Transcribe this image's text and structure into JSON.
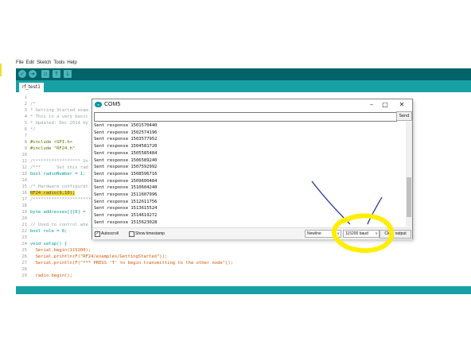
{
  "menu": [
    "File",
    "Edit",
    "Sketch",
    "Tools",
    "Help"
  ],
  "toolbar": {
    "icons": [
      "verify-icon",
      "upload-icon",
      "new-icon",
      "open-icon",
      "save-icon"
    ],
    "accent": "#006468"
  },
  "tab": {
    "label": "rf_test1"
  },
  "code": [
    {
      "n": "1",
      "t": ""
    },
    {
      "n": "2",
      "t": "/*"
    },
    {
      "n": "3",
      "t": "* Getting Started exam"
    },
    {
      "n": "4",
      "t": "* This is a very basic"
    },
    {
      "n": "5",
      "t": "* Updated: Dec 2014 by"
    },
    {
      "n": "6",
      "t": "*/"
    },
    {
      "n": "7",
      "t": ""
    },
    {
      "n": "8",
      "t": "#include <SPI.h>"
    },
    {
      "n": "9",
      "t": "#include \"RF24.h\""
    },
    {
      "n": "10",
      "t": ""
    },
    {
      "n": "11",
      "t": "/****************** Us"
    },
    {
      "n": "12",
      "t": "/***      Set this rad"
    },
    {
      "n": "13",
      "t": "bool radioNumber = 1;"
    },
    {
      "n": "14",
      "t": ""
    },
    {
      "n": "15",
      "t": "/* Hardware configurat"
    },
    {
      "n": "16",
      "t": "RF24 radio(9,10);"
    },
    {
      "n": "17",
      "t": "/**********************"
    },
    {
      "n": "18",
      "t": ""
    },
    {
      "n": "19",
      "t": "byte addresses[][6] ="
    },
    {
      "n": "20",
      "t": ""
    },
    {
      "n": "21",
      "t": "// Used to control whe"
    },
    {
      "n": "22",
      "t": "bool role = 0;"
    },
    {
      "n": "23",
      "t": ""
    },
    {
      "n": "24",
      "t": "void setup() {"
    },
    {
      "n": "25",
      "t": "  Serial.begin(115200);"
    },
    {
      "n": "26",
      "t": "  Serial.println(F(\"RF24/examples/GettingStarted\"));"
    },
    {
      "n": "27",
      "t": "  Serial.println(F(\"*** PRESS 'T' to begin transmitting to the other node\"));"
    },
    {
      "n": "28",
      "t": ""
    },
    {
      "n": "29",
      "t": "  radio.begin();"
    }
  ],
  "serial": {
    "title": "COM5",
    "logo_text": "∞",
    "send_label": "Send",
    "input_value": "",
    "output": [
      "Sent response 1501570440",
      "Sent response 1502574196",
      "Sent response 1503577952",
      "Sent response 1504581720",
      "Sent response 1505585484",
      "Sent response 1506589240",
      "Sent response 1507592992",
      "Sent response 1508596716",
      "Sent response 1509600484",
      "Sent response 1510604240",
      "Sent response 1511607996",
      "Sent response 1512611756",
      "Sent response 1513615524",
      "Sent response 1514619272",
      "Sent response 1515623028"
    ],
    "autoscroll_label": "Autoscroll",
    "autoscroll_checked": true,
    "timestamp_label": "Show timestamp",
    "timestamp_checked": false,
    "line_ending": "Newline",
    "baud": "115200 baud",
    "clear_label": "Clear output"
  },
  "colors": {
    "teal_dark": "#006468",
    "teal": "#17a1a5",
    "highlight": "#f0d22a",
    "annotation_yellow": "#ffee00",
    "annotation_arrow": "#1e2a8a"
  }
}
